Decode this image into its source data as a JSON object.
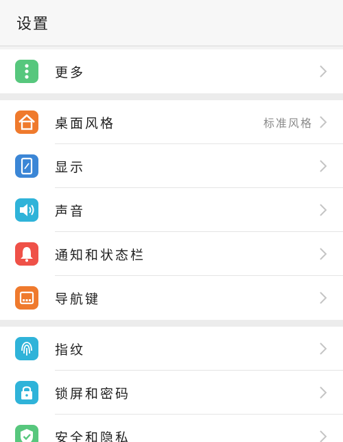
{
  "header": {
    "title": "设置"
  },
  "colors": {
    "more": "#57c77d",
    "desktop": "#ef7a2d",
    "display": "#3b86d6",
    "sound": "#2fb3d9",
    "notify": "#ef5148",
    "nav": "#ef7a2d",
    "fingerprint": "#2fb3d9",
    "lock": "#2fb3d9",
    "security": "#57c77d"
  },
  "groups": [
    {
      "items": [
        {
          "label": "更多",
          "icon": "more-dots-icon"
        }
      ]
    },
    {
      "items": [
        {
          "label": "桌面风格",
          "value": "标准风格",
          "icon": "home-icon"
        },
        {
          "label": "显示",
          "icon": "display-icon"
        },
        {
          "label": "声音",
          "icon": "speaker-icon"
        },
        {
          "label": "通知和状态栏",
          "icon": "bell-icon"
        },
        {
          "label": "导航键",
          "icon": "navigation-keys-icon"
        }
      ]
    },
    {
      "items": [
        {
          "label": "指纹",
          "icon": "fingerprint-icon"
        },
        {
          "label": "锁屏和密码",
          "icon": "lock-icon"
        },
        {
          "label": "安全和隐私",
          "icon": "shield-icon"
        }
      ]
    }
  ]
}
